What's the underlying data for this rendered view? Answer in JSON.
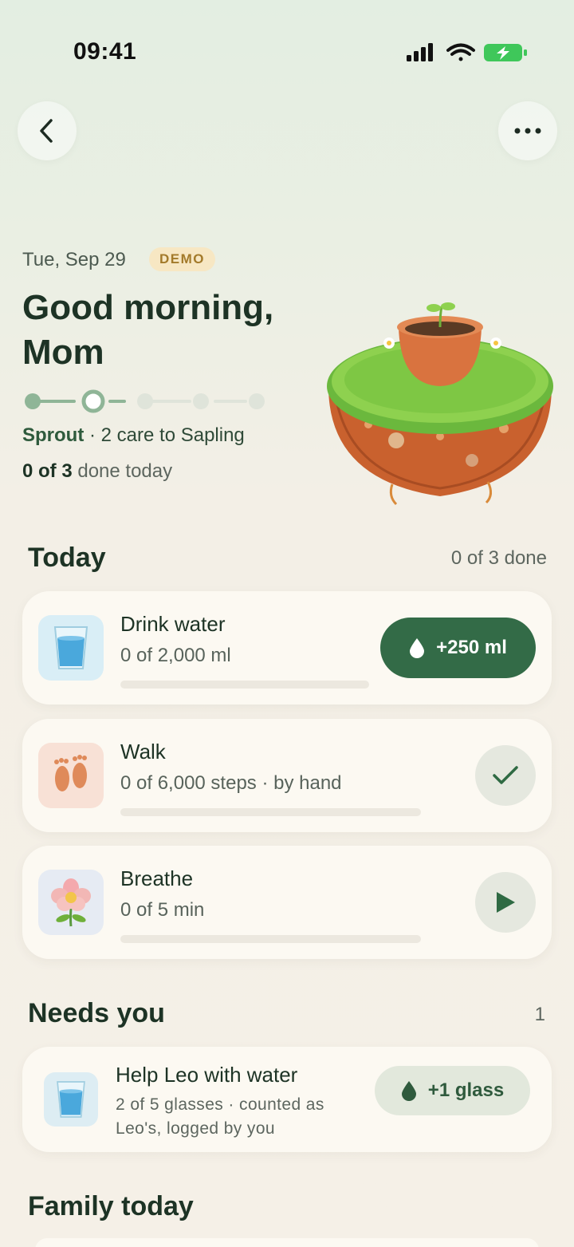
{
  "status_bar": {
    "time": "09:41"
  },
  "header": {
    "date": "Tue, Sep 29",
    "badge": "DEMO",
    "greeting_line1": "Good morning,",
    "greeting_line2": "Mom",
    "stage_name": "Sprout",
    "stage_rest": " · 2 care to Sapling",
    "done_count": "0 of 3",
    "done_rest": " done today",
    "stage_progress": {
      "total_stages": 5,
      "current_stage": 2
    }
  },
  "today": {
    "title": "Today",
    "meta": "0 of 3 done",
    "tasks": [
      {
        "title": "Drink water",
        "subtitle": "0 of 2,000 ml",
        "action_label": "+250 ml",
        "progress": 0,
        "tile_color": "#d9eef6",
        "icon": "water-glass-icon"
      },
      {
        "title": "Walk",
        "subtitle": "0 of 6,000 steps · by hand",
        "action": "check",
        "progress": 0,
        "tile_color": "#f8e1d6",
        "icon": "footprints-icon"
      },
      {
        "title": "Breathe",
        "subtitle": "0 of 5 min",
        "action": "play",
        "progress": 0,
        "tile_color": "#e6ebf3",
        "icon": "flower-icon"
      }
    ]
  },
  "needs_you": {
    "title": "Needs you",
    "count": "1",
    "items": [
      {
        "title": "Help Leo with water",
        "subtitle": "2 of 5 glasses · counted as Leo's, logged by you",
        "action_label": "+1 glass",
        "icon": "water-glass-icon"
      }
    ]
  },
  "family": {
    "title": "Family today"
  },
  "colors": {
    "accent": "#336b47",
    "background": "#f5f0e7",
    "card": "#fcf9f2"
  }
}
